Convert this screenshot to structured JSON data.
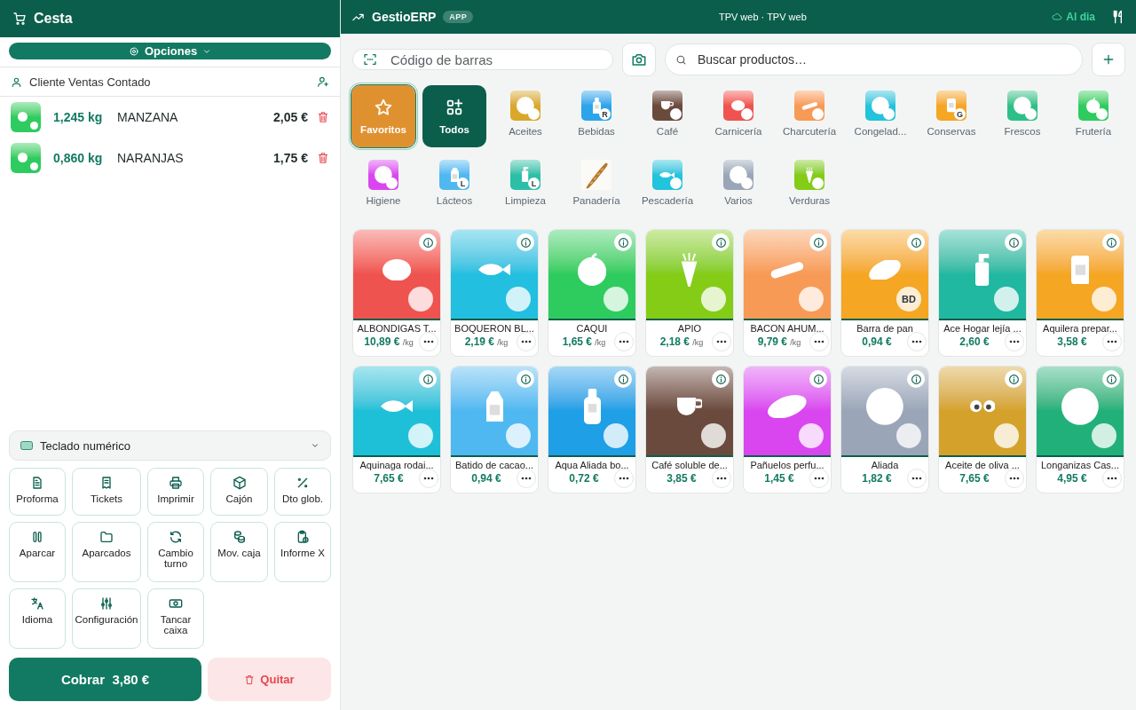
{
  "cart": {
    "title": "Cesta",
    "options": "Opciones",
    "client": "Cliente Ventas Contado",
    "lines": [
      {
        "quantity": "1,245 kg",
        "name": "MANZANA",
        "total": "2,05 €",
        "color": "#2ecc5f"
      },
      {
        "quantity": "0,860 kg",
        "name": "NARANJAS",
        "total": "1,75 €",
        "color": "#2ecc5f"
      }
    ],
    "keypad": {
      "label": "Teclado numérico",
      "expanded": false
    },
    "actions": [
      {
        "label": "Proforma",
        "kind": "doc"
      },
      {
        "label": "Tickets",
        "kind": "receipt"
      },
      {
        "label": "Imprimir",
        "kind": "printer"
      },
      {
        "label": "Cajón",
        "kind": "box"
      },
      {
        "label": "Dto glob.",
        "kind": "percent"
      },
      {
        "label": "Aparcar",
        "kind": "pause"
      },
      {
        "label": "Aparcados",
        "kind": "folder"
      },
      {
        "label": "Cambio turno",
        "kind": "refresh"
      },
      {
        "label": "Mov. caja",
        "kind": "coins"
      },
      {
        "label": "Informe X",
        "kind": "clipboard"
      },
      {
        "label": "Idioma",
        "kind": "translate"
      },
      {
        "label": "Configuración",
        "kind": "sliders"
      },
      {
        "label": "Tancar caixa",
        "kind": "cash"
      }
    ],
    "charge": {
      "label": "Cobrar",
      "amount": "3,80 €"
    },
    "remove": "Quitar"
  },
  "topbar": {
    "brand": "GestioERP",
    "badge": "APP",
    "center": "TPV web · TPV web",
    "status": "Al dia"
  },
  "barcode": {
    "placeholder": "Código de barras"
  },
  "search": {
    "placeholder": "Buscar productos…"
  },
  "categories": [
    {
      "label": "Favoritos",
      "kind": "favorites",
      "selected": true
    },
    {
      "label": "Todos",
      "kind": "all",
      "selected": false
    },
    {
      "label": "Aceites",
      "kind": "tile",
      "image": {
        "kind": "circle",
        "color": "#d9a82a"
      }
    },
    {
      "label": "Bebidas",
      "kind": "tile",
      "image": {
        "kind": "bottle",
        "color": "#2ba4ea",
        "badge": "R"
      }
    },
    {
      "label": "Café",
      "kind": "tile",
      "image": {
        "kind": "cup",
        "color": "#6b4a3e"
      }
    },
    {
      "label": "Carnicería",
      "kind": "tile",
      "image": {
        "kind": "blob",
        "color": "#ef5350"
      }
    },
    {
      "label": "Charcutería",
      "kind": "tile",
      "image": {
        "kind": "bar",
        "color": "#f79a55"
      }
    },
    {
      "label": "Congelad...",
      "kind": "tile",
      "image": {
        "kind": "circle",
        "color": "#22c3dc"
      }
    },
    {
      "label": "Conservas",
      "kind": "tile",
      "image": {
        "kind": "jar",
        "color": "#f5a623",
        "badge": "G"
      }
    },
    {
      "label": "Frescos",
      "kind": "tile",
      "image": {
        "kind": "circle",
        "color": "#2cc088"
      }
    },
    {
      "label": "Frutería",
      "kind": "tile",
      "image": {
        "kind": "apple",
        "color": "#2ecc5f"
      }
    },
    {
      "label": "Higiene",
      "kind": "tile",
      "image": {
        "kind": "circle",
        "color": "#d946ef"
      }
    },
    {
      "label": "Lácteos",
      "kind": "tile",
      "image": {
        "kind": "milk",
        "color": "#4fb8f0",
        "badge": "L"
      }
    },
    {
      "label": "Limpieza",
      "kind": "tile",
      "image": {
        "kind": "spray",
        "color": "#2bbfa8",
        "badge": "L"
      }
    },
    {
      "label": "Panadería",
      "kind": "picture"
    },
    {
      "label": "Pescadería",
      "kind": "tile",
      "image": {
        "kind": "fish",
        "color": "#22c3dc"
      }
    },
    {
      "label": "Varios",
      "kind": "tile",
      "image": {
        "kind": "circle",
        "color": "#9aa6b8"
      }
    },
    {
      "label": "Verduras",
      "kind": "tile",
      "image": {
        "kind": "carrot",
        "color": "#84cc16"
      }
    }
  ],
  "products": [
    {
      "name": "ALBONDIGAS T...",
      "price": "10,89 €",
      "unit": "/kg",
      "image": {
        "kind": "blob",
        "color": "#ef5350"
      }
    },
    {
      "name": "BOQUERON BL...",
      "price": "2,19 €",
      "unit": "/kg",
      "image": {
        "kind": "fish",
        "color": "#22bfe0"
      }
    },
    {
      "name": "CAQUI",
      "price": "1,65 €",
      "unit": "/kg",
      "image": {
        "kind": "apple",
        "color": "#2ecc5f"
      }
    },
    {
      "name": "APIO",
      "price": "2,18 €",
      "unit": "/kg",
      "image": {
        "kind": "carrot",
        "color": "#84cc16"
      }
    },
    {
      "name": "BACON AHUM...",
      "price": "9,79 €",
      "unit": "/kg",
      "image": {
        "kind": "bar",
        "color": "#f79a55"
      }
    },
    {
      "name": "Barra de pan",
      "price": "0,94 €",
      "image": {
        "kind": "bread",
        "color": "#f5a623",
        "badge": "BD"
      }
    },
    {
      "name": "Ace Hogar lejía ...",
      "price": "2,60 €",
      "image": {
        "kind": "spray",
        "color": "#20b8a0"
      }
    },
    {
      "name": "Aquilera prepar...",
      "price": "3,58 €",
      "image": {
        "kind": "jar",
        "color": "#f5a623"
      }
    },
    {
      "name": "Aquinaga rodai...",
      "price": "7,65 €",
      "image": {
        "kind": "fish",
        "color": "#1ec0d8"
      }
    },
    {
      "name": "Batido de cacao...",
      "price": "0,94 €",
      "image": {
        "kind": "milk",
        "color": "#4fb8f0"
      }
    },
    {
      "name": "Aqua Aliada bo...",
      "price": "0,72 €",
      "image": {
        "kind": "bottle",
        "color": "#1e9fe6"
      }
    },
    {
      "name": "Café soluble de...",
      "price": "3,85 €",
      "image": {
        "kind": "cup",
        "color": "#6b4a3e"
      }
    },
    {
      "name": "Pañuelos perfu...",
      "price": "1,45 €",
      "image": {
        "kind": "oval",
        "color": "#d946ef"
      }
    },
    {
      "name": "Aliada",
      "price": "1,82 €",
      "image": {
        "kind": "circle",
        "color": "#9aa6b8"
      }
    },
    {
      "name": "Aceite de oliva ...",
      "price": "7,65 €",
      "image": {
        "kind": "eyes",
        "color": "#d4a22a"
      }
    },
    {
      "name": "Longanizas Cas...",
      "price": "4,95 €",
      "image": {
        "kind": "circle",
        "color": "#22b07a"
      }
    }
  ]
}
